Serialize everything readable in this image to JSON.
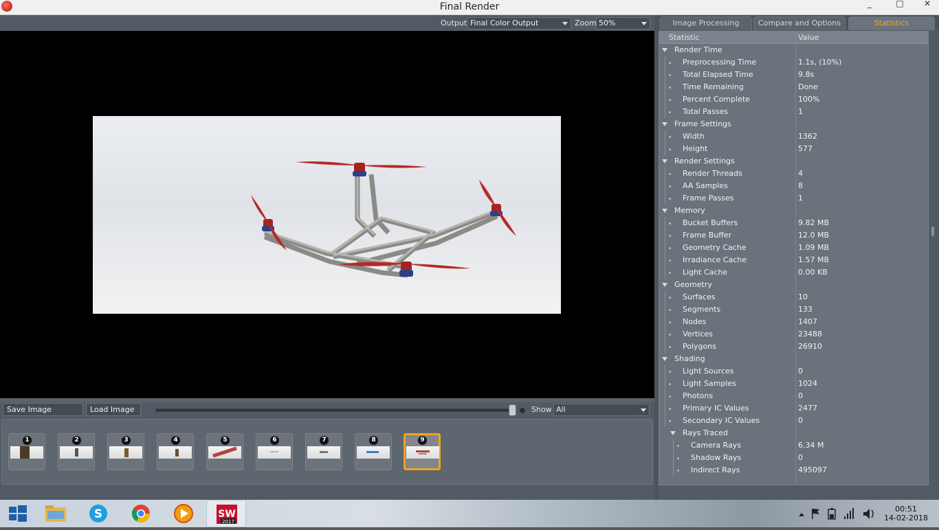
{
  "window": {
    "title": "Final Render",
    "controls": [
      "_",
      "□",
      "✕"
    ]
  },
  "toolbar": {
    "output_label": "Output",
    "output_value": "Final Color Output",
    "zoom_label": "Zoom",
    "zoom_value": "50%"
  },
  "image_bar": {
    "save_label": "Save Image",
    "load_label": "Load Image",
    "show_label": "Show",
    "show_value": "All"
  },
  "history": {
    "items": [
      "1",
      "2",
      "3",
      "4",
      "5",
      "6",
      "7",
      "8",
      "9"
    ],
    "selected": "9"
  },
  "tabs": [
    "Image Processing",
    "Compare and Options",
    "Statistics"
  ],
  "active_tab": "Statistics",
  "statistics": {
    "col_statistic": "Statistic",
    "col_value": "Value",
    "rows": [
      {
        "label": "Render Time",
        "value": "",
        "level": 0,
        "group": true
      },
      {
        "label": "Preprocessing Time",
        "value": "1.1s, (10%)",
        "level": 1
      },
      {
        "label": "Total Elapsed Time",
        "value": "9.8s",
        "level": 1
      },
      {
        "label": "Time Remaining",
        "value": "Done",
        "level": 1
      },
      {
        "label": "Percent Complete",
        "value": "100%",
        "level": 1
      },
      {
        "label": "Total Passes",
        "value": "1",
        "level": 1
      },
      {
        "label": "Frame Settings",
        "value": "",
        "level": 0,
        "group": true
      },
      {
        "label": "Width",
        "value": "1362",
        "level": 1
      },
      {
        "label": "Height",
        "value": "577",
        "level": 1
      },
      {
        "label": "Render Settings",
        "value": "",
        "level": 0,
        "group": true
      },
      {
        "label": "Render Threads",
        "value": "4",
        "level": 1
      },
      {
        "label": "AA Samples",
        "value": "8",
        "level": 1
      },
      {
        "label": "Frame Passes",
        "value": "1",
        "level": 1
      },
      {
        "label": "Memory",
        "value": "",
        "level": 0,
        "group": true
      },
      {
        "label": "Bucket Buffers",
        "value": "9.82 MB",
        "level": 1
      },
      {
        "label": "Frame Buffer",
        "value": "12.0 MB",
        "level": 1
      },
      {
        "label": "Geometry Cache",
        "value": "1.09 MB",
        "level": 1
      },
      {
        "label": "Irradiance Cache",
        "value": "1.57 MB",
        "level": 1
      },
      {
        "label": "Light Cache",
        "value": "0.00 KB",
        "level": 1
      },
      {
        "label": "Geometry",
        "value": "",
        "level": 0,
        "group": true
      },
      {
        "label": "Surfaces",
        "value": "10",
        "level": 1
      },
      {
        "label": "Segments",
        "value": "133",
        "level": 1
      },
      {
        "label": "Nodes",
        "value": "1407",
        "level": 1
      },
      {
        "label": "Vertices",
        "value": "23488",
        "level": 1
      },
      {
        "label": "Polygons",
        "value": "26910",
        "level": 1
      },
      {
        "label": "Shading",
        "value": "",
        "level": 0,
        "group": true
      },
      {
        "label": "Light Sources",
        "value": "0",
        "level": 1
      },
      {
        "label": "Light Samples",
        "value": "1024",
        "level": 1
      },
      {
        "label": "Photons",
        "value": "0",
        "level": 1
      },
      {
        "label": "Primary IC Values",
        "value": "2477",
        "level": 1
      },
      {
        "label": "Secondary IC Values",
        "value": "0",
        "level": 1
      },
      {
        "label": "Rays Traced",
        "value": "",
        "level": 1,
        "group": true
      },
      {
        "label": "Camera Rays",
        "value": "6.34 M",
        "level": 2
      },
      {
        "label": "Shadow Rays",
        "value": "0",
        "level": 2
      },
      {
        "label": "Indirect Rays",
        "value": "495097",
        "level": 2
      }
    ]
  },
  "taskbar": {
    "apps": [
      "windows-start-icon",
      "file-explorer-icon",
      "skype-icon",
      "chrome-icon",
      "media-player-icon",
      "solidworks-icon"
    ],
    "solidworks_text": "SW",
    "solidworks_version": "2017",
    "time": "00:51",
    "date": "14-02-2018"
  },
  "colors": {
    "accent": "#f6a21c",
    "panel": "#525a63",
    "propeller": "#b52a25"
  }
}
